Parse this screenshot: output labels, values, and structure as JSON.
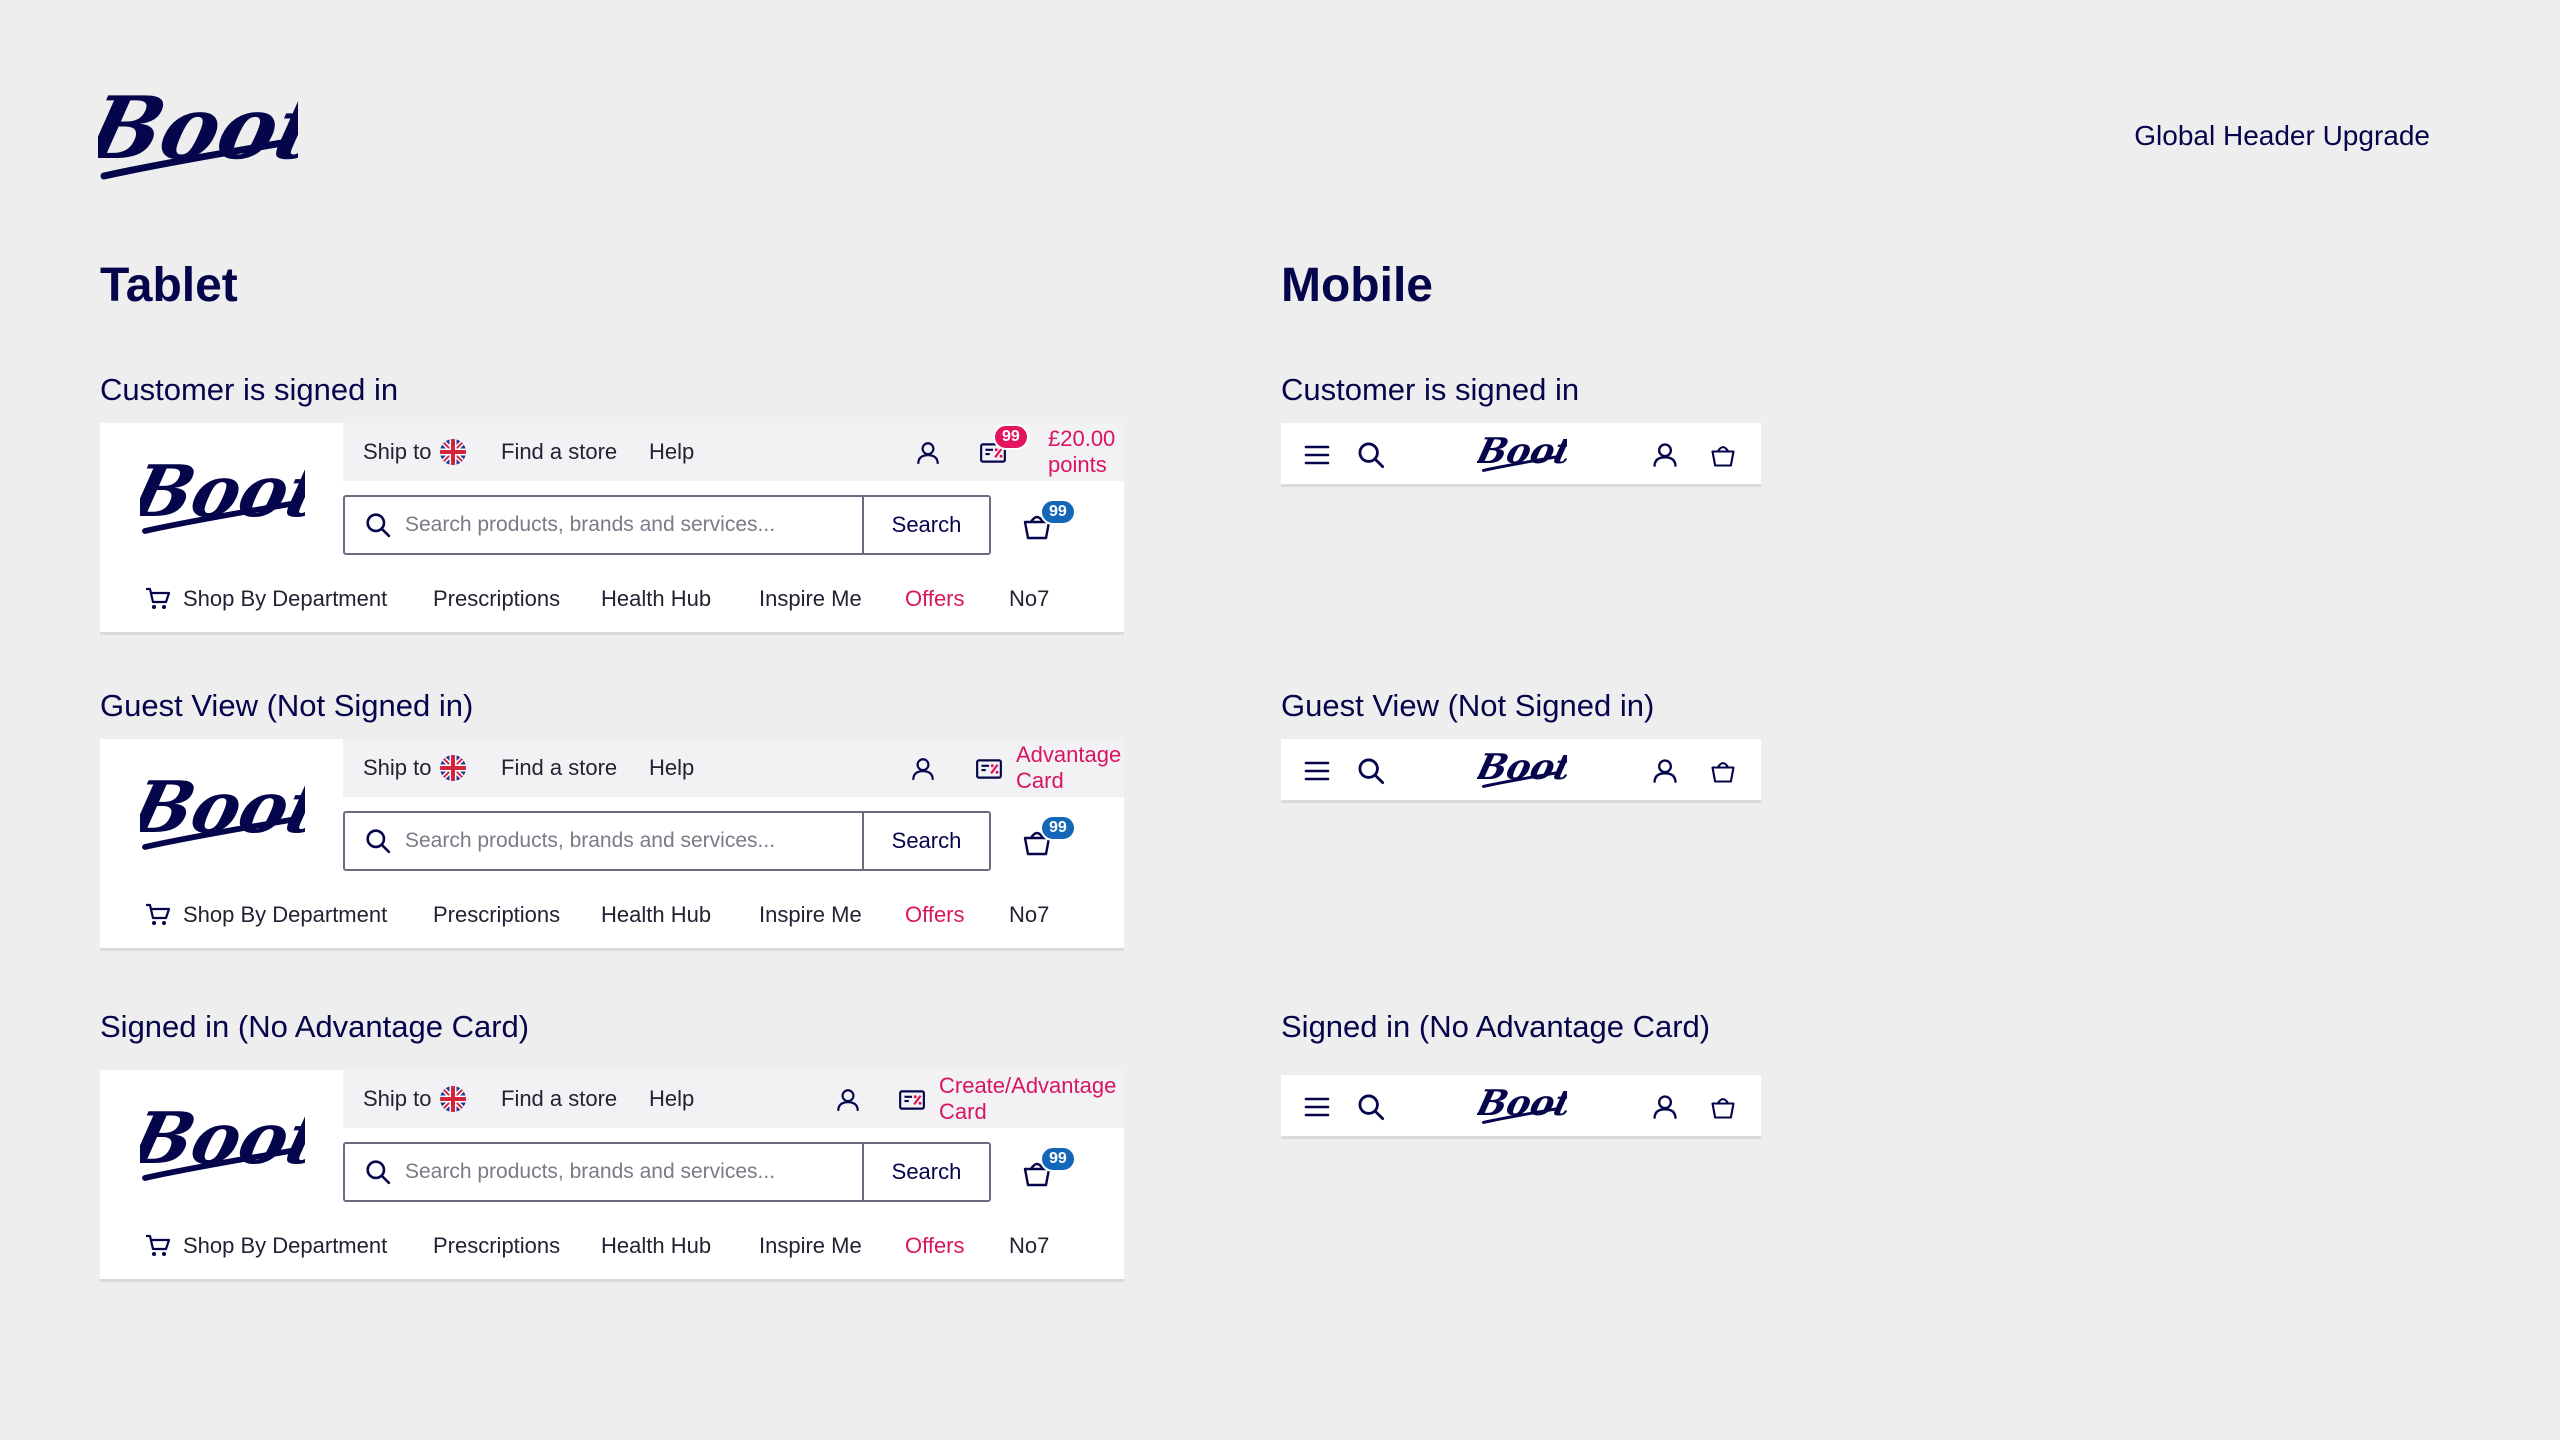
{
  "page": {
    "label": "Global Header Upgrade",
    "colors": {
      "navy": "#05054b",
      "accent_pink": "#d9155d",
      "badge_blue": "#1467b8",
      "background": "#eeeeee"
    }
  },
  "brand": {
    "name": "Boots"
  },
  "tablet": {
    "title": "Tablet",
    "variants": [
      {
        "label": "Customer is signed in",
        "ship_to": "Ship to",
        "find_store": "Find a store",
        "help": "Help",
        "card_badge": "99",
        "card_text": "£20.00 points",
        "search_placeholder": "Search products, brands and services...",
        "search_button": "Search",
        "basket_count": "99",
        "nav": {
          "shop": "Shop By Department",
          "prescriptions": "Prescriptions",
          "health": "Health Hub",
          "inspire": "Inspire Me",
          "offers": "Offers",
          "no7": "No7"
        }
      },
      {
        "label": "Guest View (Not Signed in)",
        "ship_to": "Ship to",
        "find_store": "Find a store",
        "help": "Help",
        "card_text": "Advantage Card",
        "search_placeholder": "Search products, brands and services...",
        "search_button": "Search",
        "basket_count": "99",
        "nav": {
          "shop": "Shop By Department",
          "prescriptions": "Prescriptions",
          "health": "Health Hub",
          "inspire": "Inspire Me",
          "offers": "Offers",
          "no7": "No7"
        }
      },
      {
        "label": "Signed in (No Advantage Card)",
        "ship_to": "Ship to",
        "find_store": "Find a store",
        "help": "Help",
        "card_text": "Create/Advantage Card",
        "search_placeholder": "Search products, brands and services...",
        "search_button": "Search",
        "basket_count": "99",
        "nav": {
          "shop": "Shop By Department",
          "prescriptions": "Prescriptions",
          "health": "Health Hub",
          "inspire": "Inspire Me",
          "offers": "Offers",
          "no7": "No7"
        }
      }
    ]
  },
  "mobile": {
    "title": "Mobile",
    "variants": [
      {
        "label": "Customer is signed in"
      },
      {
        "label": "Guest View (Not Signed in)"
      },
      {
        "label": "Signed in (No Advantage Card)"
      }
    ]
  },
  "icons": [
    "hamburger-menu-icon",
    "search-icon",
    "account-icon",
    "basket-icon",
    "advantage-card-icon",
    "uk-flag-icon",
    "trolley-icon"
  ]
}
